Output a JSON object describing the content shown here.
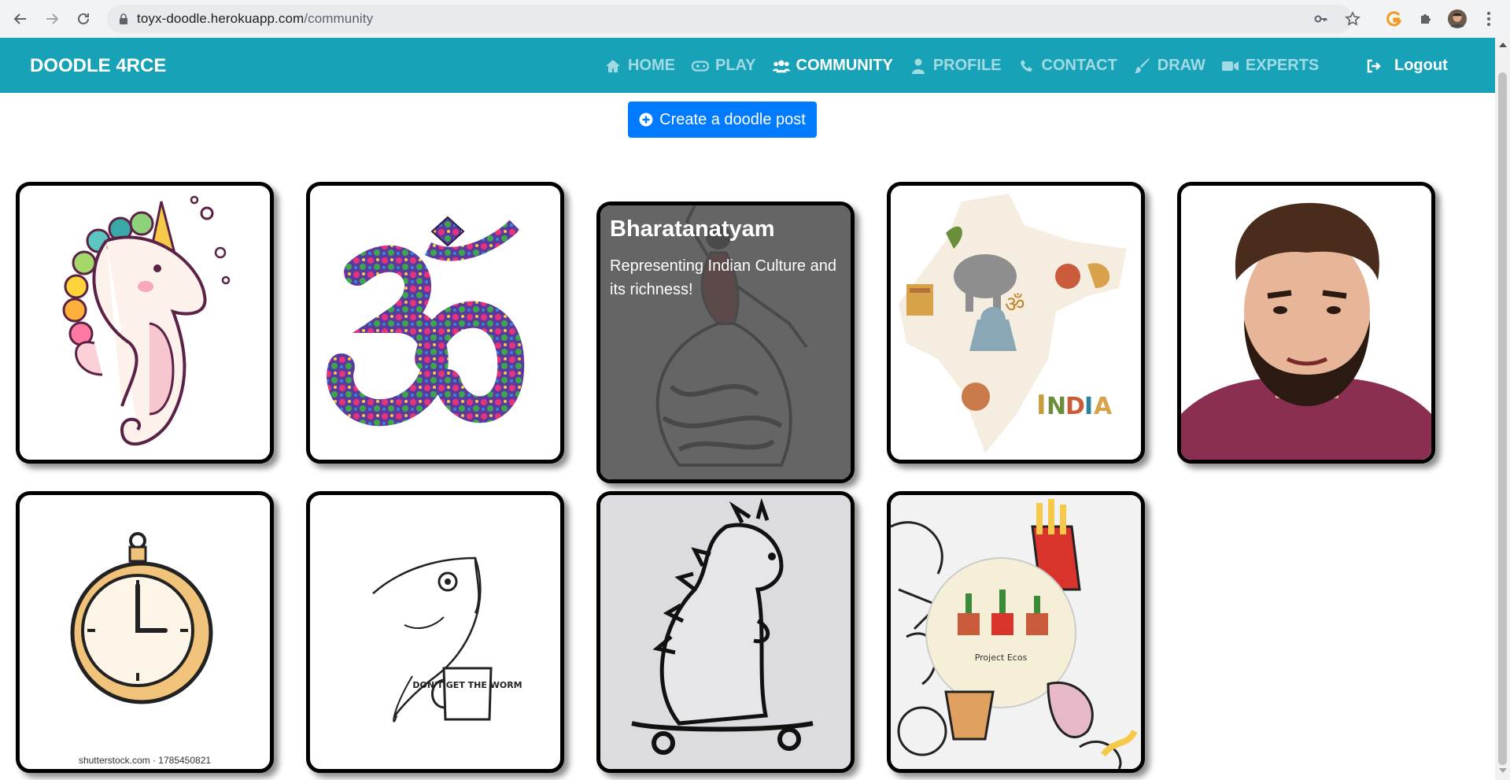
{
  "browser": {
    "url_host": "toyx-doodle.herokuapp.com",
    "url_path": "/community"
  },
  "navbar": {
    "brand": "DOODLE 4RCE",
    "links": [
      {
        "label": "HOME",
        "icon": "home-icon"
      },
      {
        "label": "PLAY",
        "icon": "gamepad-icon"
      },
      {
        "label": "COMMUNITY",
        "icon": "users-icon",
        "active": true
      },
      {
        "label": "PROFILE",
        "icon": "user-icon"
      },
      {
        "label": "CONTACT",
        "icon": "phone-icon"
      },
      {
        "label": "DRAW",
        "icon": "paintbrush-icon"
      },
      {
        "label": "EXPERTS",
        "icon": "video-camera-icon"
      }
    ],
    "logout": "Logout"
  },
  "main": {
    "create_button": "Create a doodle post",
    "cards": [
      {
        "image": "unicorn seahorse doodle"
      },
      {
        "image": "om symbol doodle"
      },
      {
        "image": "bharatanatyam dancer doodle",
        "hover_title": "Bharatanatyam",
        "hover_text": "Representing Indian Culture and its richness!"
      },
      {
        "image": "india culture map doodle"
      },
      {
        "image": "bearded man portrait"
      },
      {
        "image": "pocket watch doodle",
        "credit": "shutterstock.com · 1785450821"
      },
      {
        "image": "fish with mug doodle",
        "mug_text": "DON'T GET THE WORM"
      },
      {
        "image": "dinosaur on skateboard doodle"
      },
      {
        "image": "sticker collage photo",
        "badge_text": "Project Ecos"
      }
    ]
  },
  "colors": {
    "navbar": "#17a2b8",
    "primary_button": "#007bff",
    "card_overlay": "#505050"
  }
}
